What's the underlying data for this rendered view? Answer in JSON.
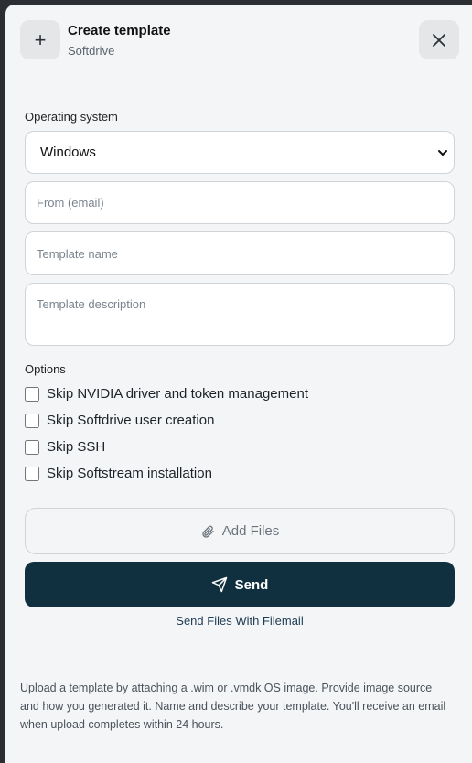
{
  "header": {
    "add_icon": "plus-icon",
    "title": "Create template",
    "subtitle": "Softdrive",
    "close_icon": "close-icon"
  },
  "form": {
    "os_label": "Operating system",
    "os_selected": "Windows",
    "email_placeholder": "From (email)",
    "name_placeholder": "Template name",
    "description_placeholder": "Template description",
    "options_label": "Options",
    "options": [
      {
        "label": "Skip NVIDIA driver and token management",
        "checked": false
      },
      {
        "label": "Skip Softdrive user creation",
        "checked": false
      },
      {
        "label": "Skip SSH",
        "checked": false
      },
      {
        "label": "Skip Softstream installation",
        "checked": false
      }
    ]
  },
  "actions": {
    "add_files_label": "Add Files",
    "add_files_icon": "paperclip-icon",
    "send_label": "Send",
    "send_icon": "paper-plane-icon",
    "filemail_link": "Send Files With Filemail"
  },
  "info_text": "Upload a template by attaching a .wim or .vmdk OS image. Provide image source and how you generated it. Name and describe your template. You'll receive an email when upload completes within 24 hours.",
  "colors": {
    "panel_bg": "#f4f5f6",
    "send_bg": "#10303f",
    "link": "#1e3c55"
  }
}
